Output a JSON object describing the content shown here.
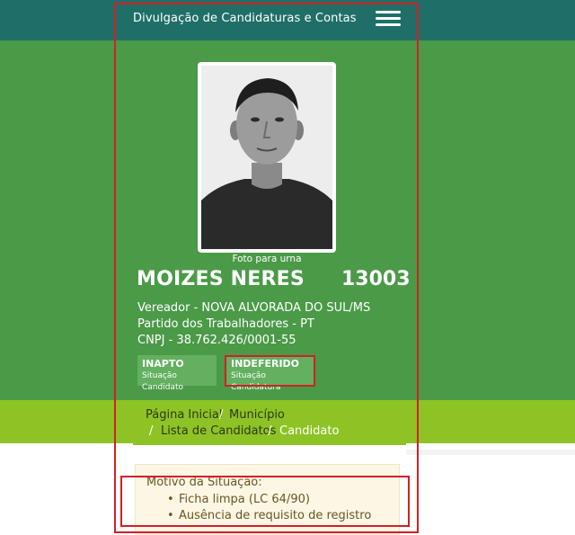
{
  "header": {
    "title": "Divulgação de Candidaturas e Contas",
    "menu_icon": "hamburger-menu-icon"
  },
  "candidate": {
    "photo_caption": "Foto para urna",
    "name": "MOIZES NERES",
    "number": "13003",
    "office": "Vereador - NOVA ALVORADA DO SUL/MS",
    "party": "Partido dos Trabalhadores - PT",
    "cnpj": "CNPJ - 38.762.426/0001-55"
  },
  "status": {
    "candidate": {
      "value": "INAPTO",
      "label": "Situação Candidato"
    },
    "candidacy": {
      "value": "INDEFERIDO",
      "label": "Situação Candidatura"
    }
  },
  "breadcrumb": {
    "items": [
      "Página Inicial",
      "Município",
      "Lista de Candidatos",
      "Candidato"
    ],
    "separator": "/"
  },
  "motive": {
    "title": "Motivo da Situação:",
    "items": [
      "Ficha limpa (LC 64/90)",
      "Ausência de requisito de registro"
    ]
  },
  "colors": {
    "topbar": "#1f6f68",
    "hero": "#4a9a48",
    "badge": "#62b060",
    "breadcrumb_band": "#8ec325",
    "motive_bg": "#fcf7e4",
    "annotation_red": "#d41f26"
  }
}
